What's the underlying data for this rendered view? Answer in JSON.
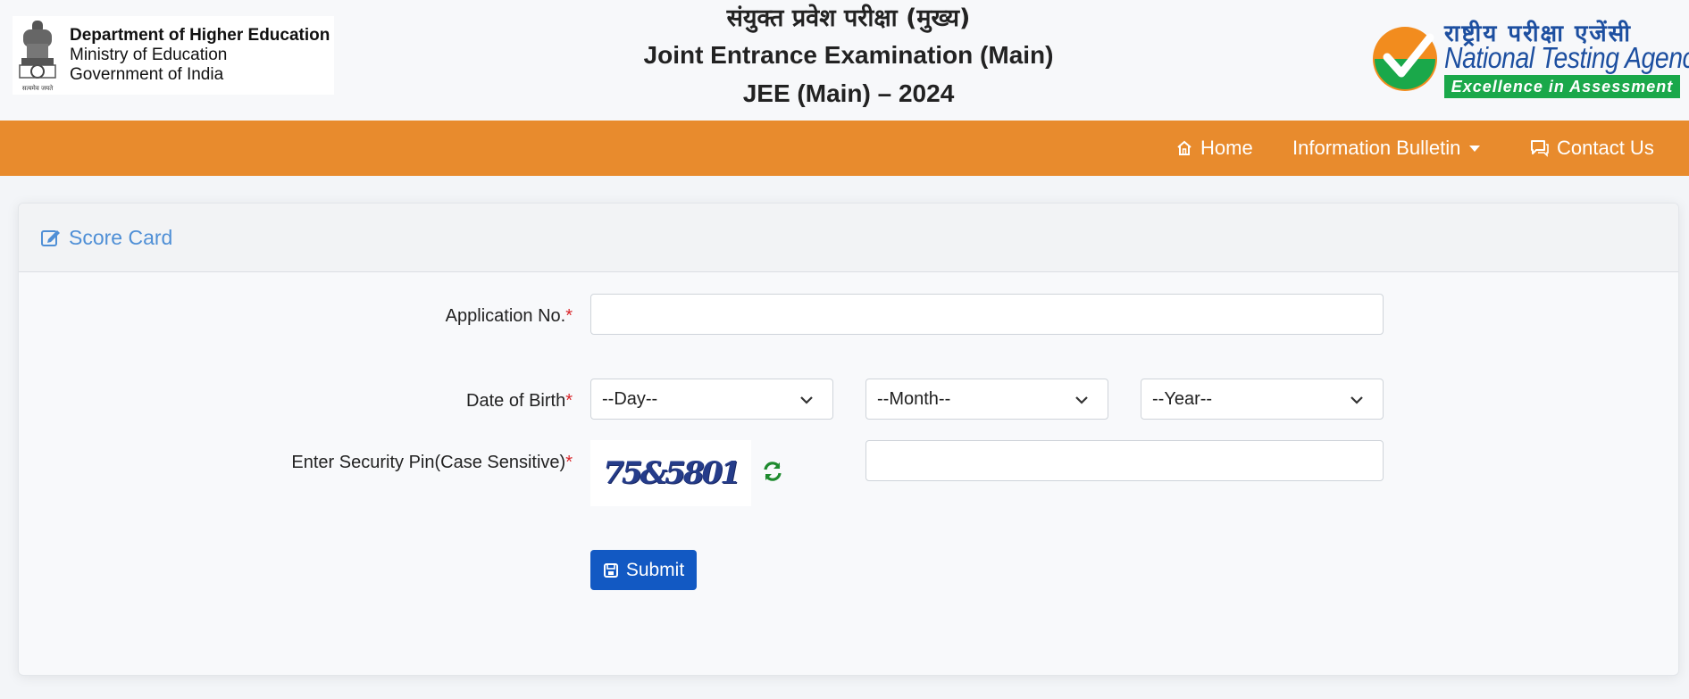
{
  "header": {
    "dept_line1": "Department of Higher Education",
    "dept_line2": "Ministry of Education",
    "dept_line3": "Government of India",
    "emblem_caption": "सत्यमेव जयते",
    "title_hindi": "संयुक्त प्रवेश परीक्षा (मुख्य)",
    "title_en": "Joint Entrance Examination (Main)",
    "title_year": "JEE (Main) – 2024",
    "nta_hindi": "राष्ट्रीय परीक्षा एजेंसी",
    "nta_en": "National Testing Agency",
    "nta_tagline": "Excellence in Assessment"
  },
  "nav": {
    "home": "Home",
    "info_bulletin": "Information Bulletin",
    "contact": "Contact Us",
    "bg_color": "#e88b2d"
  },
  "card": {
    "title": "Score Card"
  },
  "form": {
    "application_label": "Application No.",
    "application_value": "",
    "dob_label": "Date of Birth",
    "day_selected": "--Day--",
    "month_selected": "--Month--",
    "year_selected": "--Year--",
    "pin_label": "Enter Security Pin(Case Sensitive)",
    "captcha_text": "75&5801",
    "pin_value": "",
    "required_mark": "*",
    "submit_label": "Submit"
  },
  "colors": {
    "accent": "#4f8fd6",
    "submit": "#1259c3",
    "refresh": "#1e8a2e",
    "required": "#d9262b"
  }
}
